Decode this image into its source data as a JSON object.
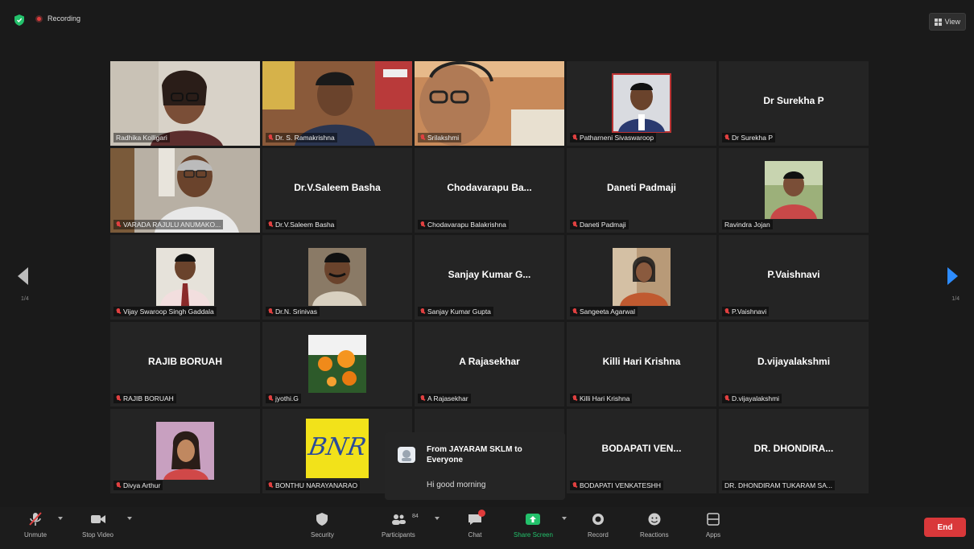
{
  "topbar": {
    "recording_label": "Recording",
    "view_label": "View"
  },
  "pagination": {
    "left": "1/4",
    "right": "1/4"
  },
  "participants": [
    {
      "label": "Radhika Kolligari",
      "name_card": "",
      "video": "woman-glasses",
      "active": true,
      "muted": false
    },
    {
      "label": "Dr. S. Ramakrishna",
      "name_card": "",
      "video": "man-bookshelf",
      "muted": true
    },
    {
      "label": "Srilakshmi",
      "name_card": "",
      "video": "elder-headset",
      "muted": true
    },
    {
      "label": "Patharneni Sivaswaroop",
      "name_card": "",
      "video": "man-portrait",
      "muted": true
    },
    {
      "label": "Dr Surekha P",
      "name_card": "Dr Surekha P",
      "video": "",
      "muted": true
    },
    {
      "label": "VARADA RAJULU ANUMAKO...",
      "name_card": "",
      "video": "elder-man",
      "muted": true
    },
    {
      "label": "Dr.V.Saleem Basha",
      "name_card": "Dr.V.Saleem Basha",
      "video": "",
      "muted": true
    },
    {
      "label": "Chodavarapu Balakrishna",
      "name_card": "Chodavarapu Ba...",
      "video": "",
      "muted": true
    },
    {
      "label": "Daneti Padmaji",
      "name_card": "Daneti Padmaji",
      "video": "",
      "muted": true
    },
    {
      "label": "Ravindra Jojan",
      "name_card": "",
      "video": "man-outdoor",
      "muted": false
    },
    {
      "label": "Vijay Swaroop Singh Gaddala",
      "name_card": "",
      "video": "man-tie",
      "muted": true
    },
    {
      "label": "Dr.N. Srinivas",
      "name_card": "",
      "video": "man-portrait2",
      "muted": true
    },
    {
      "label": "Sanjay Kumar Gupta",
      "name_card": "Sanjay Kumar G...",
      "video": "",
      "muted": true
    },
    {
      "label": "Sangeeta Agarwal",
      "name_card": "",
      "video": "woman-portrait",
      "muted": true
    },
    {
      "label": "P.Vaishnavi",
      "name_card": "P.Vaishnavi",
      "video": "",
      "muted": true
    },
    {
      "label": "RAJIB BORUAH",
      "name_card": "RAJIB BORUAH",
      "video": "",
      "muted": true
    },
    {
      "label": "jyothi.G",
      "name_card": "",
      "video": "flowers",
      "muted": true
    },
    {
      "label": "A Rajasekhar",
      "name_card": "A Rajasekhar",
      "video": "",
      "muted": true
    },
    {
      "label": "Killi Hari Krishna",
      "name_card": "Killi Hari Krishna",
      "video": "",
      "muted": true
    },
    {
      "label": "D.vijayalakshmi",
      "name_card": "D.vijayalakshmi",
      "video": "",
      "muted": true
    },
    {
      "label": "Divya Arthur",
      "name_card": "",
      "video": "girl-portrait",
      "muted": true
    },
    {
      "label": "BONTHU NARAYANARAO",
      "name_card": "",
      "video": "bnr-logo",
      "logo_text": "BNR",
      "muted": true
    },
    {
      "label": "",
      "name_card": "",
      "video": "",
      "muted": false
    },
    {
      "label": "BODAPATI VENKATESHH",
      "name_card": "BODAPATI VEN...",
      "video": "",
      "muted": true
    },
    {
      "label": "DR. DHONDIRAM TUKARAM SA...",
      "name_card": "DR. DHONDIRA...",
      "video": "",
      "muted": false
    }
  ],
  "chat_popup": {
    "from": "From JAYARAM SKLM to Everyone",
    "message": "Hi good morning"
  },
  "toolbar": {
    "unmute": "Unmute",
    "stop_video": "Stop Video",
    "security": "Security",
    "participants": "Participants",
    "participants_count": "84",
    "chat": "Chat",
    "share_screen": "Share Screen",
    "record": "Record",
    "reactions": "Reactions",
    "apps": "Apps",
    "end": "End"
  },
  "colors": {
    "share_green": "#23c16b",
    "end_red": "#d9383a",
    "active_border": "#b5d67a",
    "nav_blue": "#2d8cff"
  }
}
